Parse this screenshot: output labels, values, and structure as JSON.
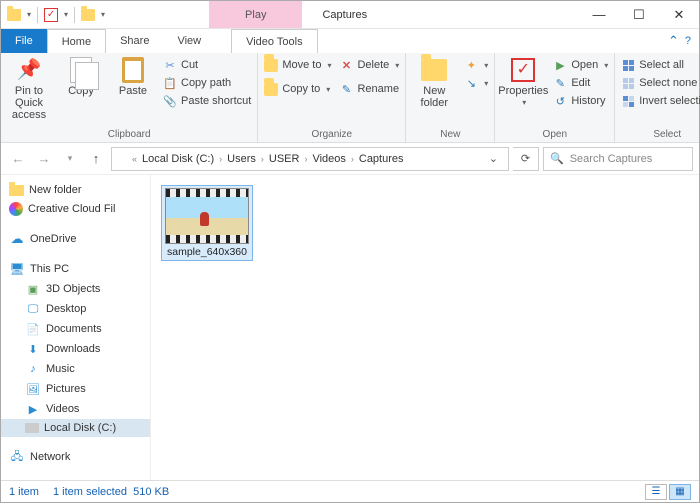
{
  "window": {
    "title": "Captures",
    "context_tab": "Play",
    "context_tools": "Video Tools"
  },
  "tabs": {
    "file": "File",
    "home": "Home",
    "share": "Share",
    "view": "View"
  },
  "ribbon": {
    "clipboard": {
      "label": "Clipboard",
      "pin": "Pin to Quick access",
      "copy": "Copy",
      "paste": "Paste",
      "cut": "Cut",
      "copy_path": "Copy path",
      "paste_shortcut": "Paste shortcut"
    },
    "organize": {
      "label": "Organize",
      "move_to": "Move to",
      "copy_to": "Copy to",
      "delete": "Delete",
      "rename": "Rename"
    },
    "new": {
      "label": "New",
      "new_folder": "New folder"
    },
    "open": {
      "label": "Open",
      "properties": "Properties",
      "open": "Open",
      "edit": "Edit",
      "history": "History"
    },
    "select": {
      "label": "Select",
      "all": "Select all",
      "none": "Select none",
      "invert": "Invert selection"
    }
  },
  "breadcrumb": [
    "Local Disk (C:)",
    "Users",
    "USER",
    "Videos",
    "Captures"
  ],
  "search": {
    "placeholder": "Search Captures"
  },
  "tree": {
    "new_folder": "New folder",
    "creative": "Creative Cloud Fil",
    "onedrive": "OneDrive",
    "this_pc": "This PC",
    "children": [
      "3D Objects",
      "Desktop",
      "Documents",
      "Downloads",
      "Music",
      "Pictures",
      "Videos",
      "Local Disk (C:)"
    ],
    "network": "Network"
  },
  "files": [
    {
      "name": "sample_640x360"
    }
  ],
  "status": {
    "count": "1 item",
    "selected": "1 item selected",
    "size": "510 KB"
  }
}
